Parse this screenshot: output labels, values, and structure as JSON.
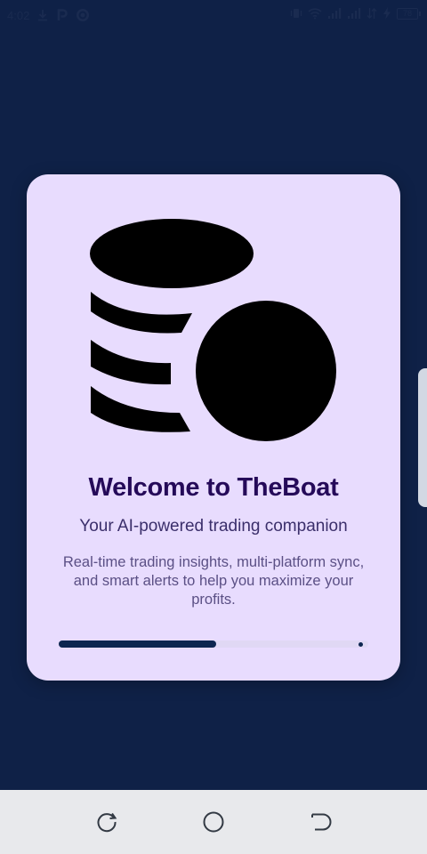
{
  "status_bar": {
    "time": "4:02",
    "left_icons": [
      "download-icon",
      "p-app-icon",
      "circle-app-icon"
    ],
    "right_icons": [
      "vibrate-icon",
      "wifi-icon",
      "signal-icon",
      "signal-icon",
      "data-icon",
      "charging-icon"
    ],
    "battery": "78"
  },
  "onboarding": {
    "illustration_icon": "coins-icon",
    "title": "Welcome to TheBoat",
    "subtitle": "Your AI-powered trading companion",
    "description": "Real-time trading insights, multi-platform sync, and smart alerts to help you maximize your profits.",
    "progress": 0.51
  },
  "colors": {
    "background": "#0f2147",
    "card": "#e8dcfe",
    "title": "#250a59",
    "accent": "#0d2650"
  },
  "nav_bar": {
    "buttons": [
      "recent-apps-icon",
      "home-icon",
      "back-icon"
    ]
  }
}
